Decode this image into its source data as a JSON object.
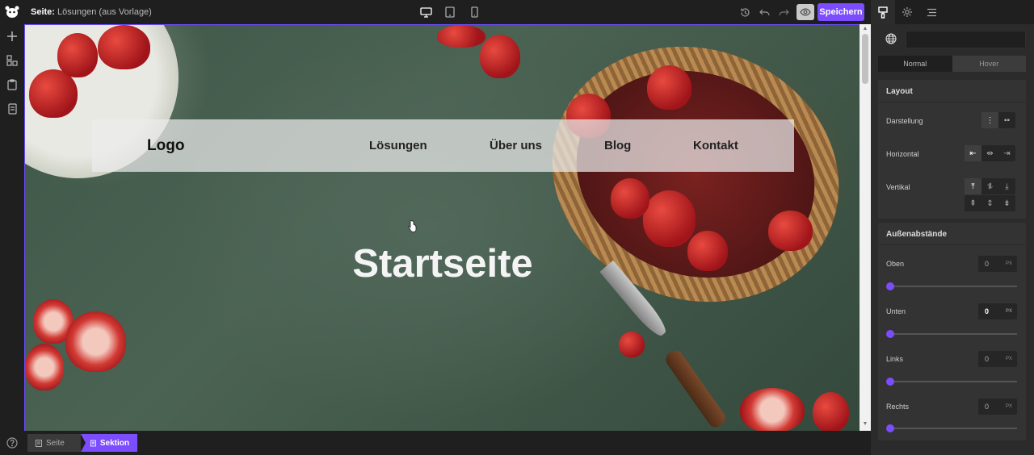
{
  "topbar": {
    "page_prefix": "Seite:",
    "page_name": "Lösungen (aus Vorlage)",
    "save_label": "Speichern"
  },
  "canvas": {
    "nav": {
      "logo": "Logo",
      "links": [
        "Lösungen",
        "Über uns",
        "Blog",
        "Kontakt"
      ]
    },
    "hero_title": "Startseite"
  },
  "breadcrumb": {
    "items": [
      "Seite",
      "Sektion"
    ]
  },
  "panel": {
    "state_tabs": [
      "Normal",
      "Hover"
    ],
    "layout": {
      "title": "Layout",
      "display_label": "Darstellung",
      "horizontal_label": "Horizontal",
      "vertical_label": "Vertikal"
    },
    "margins": {
      "title": "Außenabstände",
      "unit": "PX",
      "fields": [
        {
          "label": "Oben",
          "value": "0"
        },
        {
          "label": "Unten",
          "value": "0"
        },
        {
          "label": "Links",
          "value": "0"
        },
        {
          "label": "Rechts",
          "value": "0"
        }
      ]
    }
  },
  "colors": {
    "accent": "#7c4dff",
    "panel_bg": "#2b2b2b",
    "app_bg": "#1f1f1f"
  }
}
